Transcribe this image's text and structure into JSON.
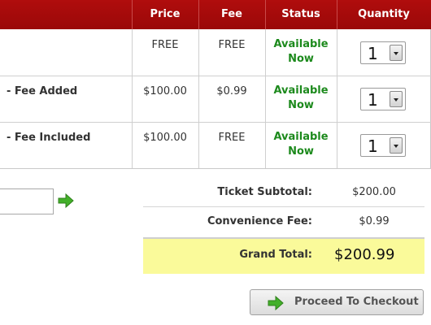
{
  "colors": {
    "header_bg": "#a80a0a",
    "status_green": "#1d8a1d",
    "grand_total_bg": "#fafa9a",
    "arrow_green": "#43b02a"
  },
  "columns": {
    "price": "Price",
    "fee": "Fee",
    "status": "Status",
    "quantity": "Quantity"
  },
  "tickets": [
    {
      "name": "",
      "price": "FREE",
      "fee": "FREE",
      "status": "Available\nNow",
      "quantity": "1"
    },
    {
      "name": "- Fee Added",
      "price": "$100.00",
      "fee": "$0.99",
      "status": "Available\nNow",
      "quantity": "1"
    },
    {
      "name": "- Fee Included",
      "price": "$100.00",
      "fee": "FREE",
      "status": "Available\nNow",
      "quantity": "1"
    }
  ],
  "promo": {
    "value": "",
    "go_icon": "green-arrow-icon"
  },
  "summary": {
    "subtotal_label": "Ticket Subtotal:",
    "subtotal_value": "$200.00",
    "fee_label": "Convenience Fee:",
    "fee_value": "$0.99",
    "grand_label": "Grand Total:",
    "grand_value": "$200.99"
  },
  "checkout": {
    "label": "Proceed To Checkout",
    "icon": "green-arrow-icon"
  }
}
